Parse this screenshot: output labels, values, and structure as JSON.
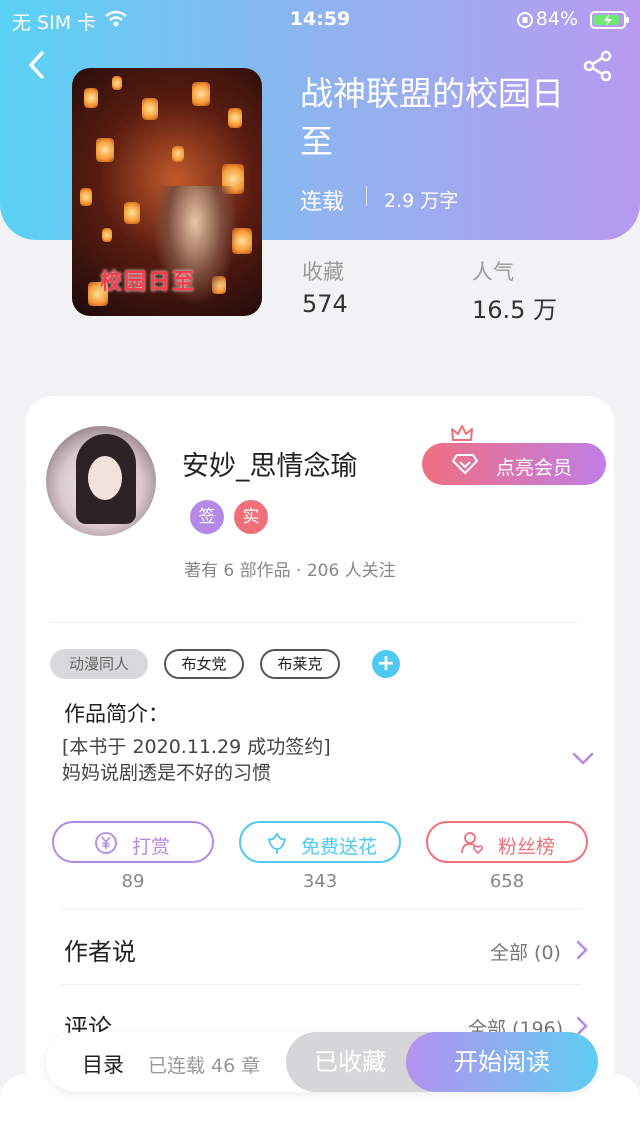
{
  "status_bar": {
    "carrier": "无 SIM 卡",
    "time": "14:59",
    "battery": "84%"
  },
  "book": {
    "title": "战神联盟的校园日至",
    "status": "连载",
    "word_count": "2.9 万字",
    "cover_text": "校园日至",
    "stats": [
      {
        "label": "收藏",
        "value": "574"
      },
      {
        "label": "人气",
        "value": "16.5 万"
      }
    ]
  },
  "author": {
    "name": "安妙_思情念瑜",
    "vip_button": "点亮会员",
    "badges": [
      {
        "label": "签",
        "color": "#b58ae6"
      },
      {
        "label": "实",
        "color": "#f0707a"
      }
    ],
    "summary": "著有 6 部作品 · 206 人关注"
  },
  "tags": [
    "动漫同人",
    "布女党",
    "布莱克",
    "+"
  ],
  "intro": {
    "title": "作品简介：",
    "lines": [
      "[本书于 2020.11.29 成功签约]",
      "妈妈说剧透是不好的习惯"
    ]
  },
  "actions": [
    {
      "label": "打赏",
      "count": "89",
      "color": "#b58ae6"
    },
    {
      "label": "免费送花",
      "count": "343",
      "color": "#4fc9f0"
    },
    {
      "label": "粉丝榜",
      "count": "658",
      "color": "#f0707a"
    }
  ],
  "sections": [
    {
      "title": "作者说",
      "meta": "全部 (0)"
    },
    {
      "title": "评论",
      "meta": "全部 (196)"
    }
  ],
  "bottom_bar": {
    "catalog": "目录",
    "chapters": "已连载 46 章",
    "collected": "已收藏",
    "read": "开始阅读"
  },
  "colors": {
    "accent_purple": "#b58ae6",
    "accent_cyan": "#4fc9f0",
    "accent_pink": "#f0707a"
  }
}
